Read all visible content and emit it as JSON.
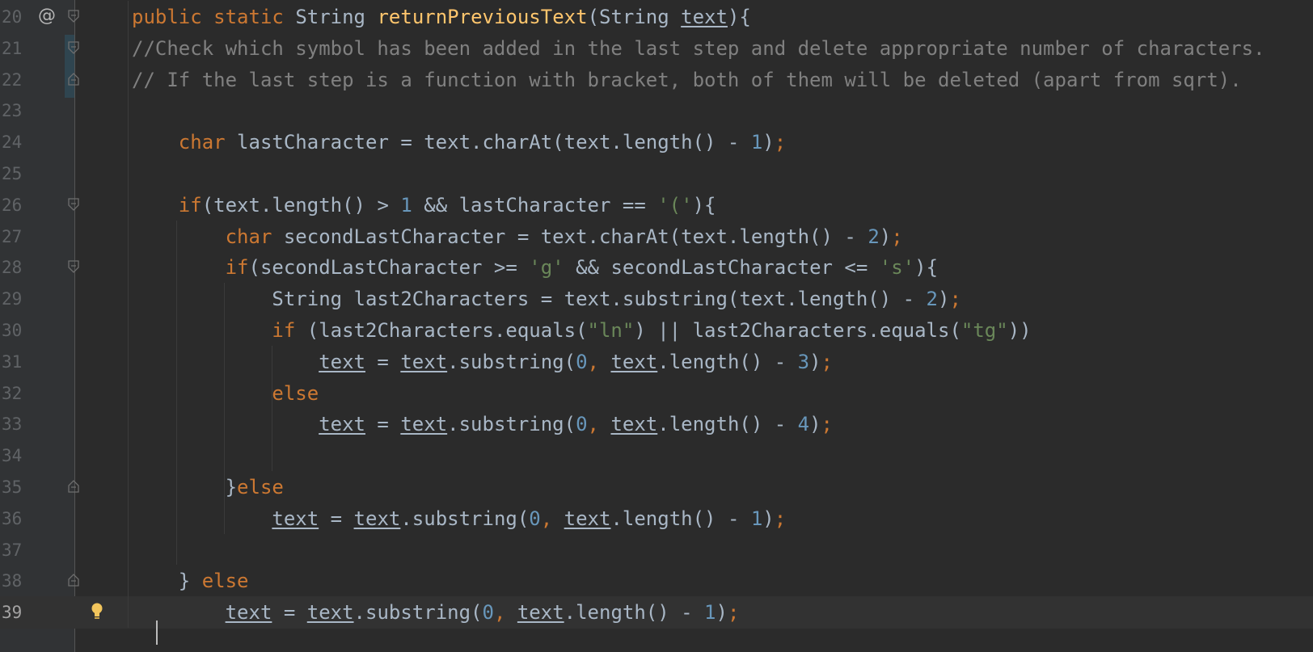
{
  "editor": {
    "language": "Java",
    "current_line": 39,
    "lines": [
      {
        "number": "20",
        "tokens": [
          {
            "t": "public ",
            "c": "kw"
          },
          {
            "t": "static ",
            "c": "kw"
          },
          {
            "t": "String ",
            "c": ""
          },
          {
            "t": "returnPreviousText",
            "c": "fn"
          },
          {
            "t": "(String ",
            "c": ""
          },
          {
            "t": "text",
            "c": "param"
          },
          {
            "t": "){",
            "c": ""
          }
        ]
      },
      {
        "number": "21",
        "tokens": [
          {
            "t": "//Check which symbol has been added in the last step and delete appropriate number of characters.",
            "c": "cm"
          }
        ]
      },
      {
        "number": "22",
        "tokens": [
          {
            "t": "// If the last step is a function with bracket, both of them will be deleted (apart from sqrt).",
            "c": "cm"
          }
        ]
      },
      {
        "number": "23",
        "tokens": []
      },
      {
        "number": "24",
        "tokens": [
          {
            "t": "    ",
            "c": ""
          },
          {
            "t": "char ",
            "c": "kw"
          },
          {
            "t": "lastCharacter = text.charAt(text.length() - ",
            "c": ""
          },
          {
            "t": "1",
            "c": "num"
          },
          {
            "t": ")",
            "c": ""
          },
          {
            "t": ";",
            "c": "kw"
          }
        ]
      },
      {
        "number": "25",
        "tokens": []
      },
      {
        "number": "26",
        "tokens": [
          {
            "t": "    ",
            "c": ""
          },
          {
            "t": "if",
            "c": "kw"
          },
          {
            "t": "(text.length() > ",
            "c": ""
          },
          {
            "t": "1",
            "c": "num"
          },
          {
            "t": " && lastCharacter == ",
            "c": ""
          },
          {
            "t": "'('",
            "c": "str"
          },
          {
            "t": "){",
            "c": ""
          }
        ]
      },
      {
        "number": "27",
        "tokens": [
          {
            "t": "        ",
            "c": ""
          },
          {
            "t": "char ",
            "c": "kw"
          },
          {
            "t": "secondLastCharacter = text.charAt(text.length() - ",
            "c": ""
          },
          {
            "t": "2",
            "c": "num"
          },
          {
            "t": ")",
            "c": ""
          },
          {
            "t": ";",
            "c": "kw"
          }
        ]
      },
      {
        "number": "28",
        "tokens": [
          {
            "t": "        ",
            "c": ""
          },
          {
            "t": "if",
            "c": "kw"
          },
          {
            "t": "(secondLastCharacter >= ",
            "c": ""
          },
          {
            "t": "'g'",
            "c": "str"
          },
          {
            "t": " && secondLastCharacter <= ",
            "c": ""
          },
          {
            "t": "'s'",
            "c": "str"
          },
          {
            "t": "){",
            "c": ""
          }
        ]
      },
      {
        "number": "29",
        "tokens": [
          {
            "t": "            String last2Characters = text.substring(text.length() - ",
            "c": ""
          },
          {
            "t": "2",
            "c": "num"
          },
          {
            "t": ")",
            "c": ""
          },
          {
            "t": ";",
            "c": "kw"
          }
        ]
      },
      {
        "number": "30",
        "tokens": [
          {
            "t": "            ",
            "c": ""
          },
          {
            "t": "if ",
            "c": "kw"
          },
          {
            "t": "(last2Characters.equals(",
            "c": ""
          },
          {
            "t": "\"ln\"",
            "c": "str"
          },
          {
            "t": ") || last2Characters.equals(",
            "c": ""
          },
          {
            "t": "\"tg\"",
            "c": "str"
          },
          {
            "t": "))",
            "c": ""
          }
        ]
      },
      {
        "number": "31",
        "tokens": [
          {
            "t": "                ",
            "c": ""
          },
          {
            "t": "text",
            "c": "param"
          },
          {
            "t": " = ",
            "c": ""
          },
          {
            "t": "text",
            "c": "param"
          },
          {
            "t": ".substring(",
            "c": ""
          },
          {
            "t": "0",
            "c": "num"
          },
          {
            "t": ", ",
            "c": "kw"
          },
          {
            "t": "text",
            "c": "param"
          },
          {
            "t": ".length() - ",
            "c": ""
          },
          {
            "t": "3",
            "c": "num"
          },
          {
            "t": ")",
            "c": ""
          },
          {
            "t": ";",
            "c": "kw"
          }
        ]
      },
      {
        "number": "32",
        "tokens": [
          {
            "t": "            ",
            "c": ""
          },
          {
            "t": "else",
            "c": "kw"
          }
        ]
      },
      {
        "number": "33",
        "tokens": [
          {
            "t": "                ",
            "c": ""
          },
          {
            "t": "text",
            "c": "param"
          },
          {
            "t": " = ",
            "c": ""
          },
          {
            "t": "text",
            "c": "param"
          },
          {
            "t": ".substring(",
            "c": ""
          },
          {
            "t": "0",
            "c": "num"
          },
          {
            "t": ", ",
            "c": "kw"
          },
          {
            "t": "text",
            "c": "param"
          },
          {
            "t": ".length() - ",
            "c": ""
          },
          {
            "t": "4",
            "c": "num"
          },
          {
            "t": ")",
            "c": ""
          },
          {
            "t": ";",
            "c": "kw"
          }
        ]
      },
      {
        "number": "34",
        "tokens": []
      },
      {
        "number": "35",
        "tokens": [
          {
            "t": "        }",
            "c": ""
          },
          {
            "t": "else",
            "c": "kw"
          }
        ]
      },
      {
        "number": "36",
        "tokens": [
          {
            "t": "            ",
            "c": ""
          },
          {
            "t": "text",
            "c": "param"
          },
          {
            "t": " = ",
            "c": ""
          },
          {
            "t": "text",
            "c": "param"
          },
          {
            "t": ".substring(",
            "c": ""
          },
          {
            "t": "0",
            "c": "num"
          },
          {
            "t": ", ",
            "c": "kw"
          },
          {
            "t": "text",
            "c": "param"
          },
          {
            "t": ".length() - ",
            "c": ""
          },
          {
            "t": "1",
            "c": "num"
          },
          {
            "t": ")",
            "c": ""
          },
          {
            "t": ";",
            "c": "kw"
          }
        ]
      },
      {
        "number": "37",
        "tokens": []
      },
      {
        "number": "38",
        "tokens": [
          {
            "t": "    } ",
            "c": ""
          },
          {
            "t": "else",
            "c": "kw"
          }
        ]
      },
      {
        "number": "39",
        "tokens": [
          {
            "t": "        ",
            "c": ""
          },
          {
            "t": "text",
            "c": "param"
          },
          {
            "t": " = ",
            "c": ""
          },
          {
            "t": "text",
            "c": "param"
          },
          {
            "t": ".substring(",
            "c": ""
          },
          {
            "t": "0",
            "c": "num"
          },
          {
            "t": ", ",
            "c": "kw"
          },
          {
            "t": "text",
            "c": "param"
          },
          {
            "t": ".length() - ",
            "c": ""
          },
          {
            "t": "1",
            "c": "num"
          },
          {
            "t": ")",
            "c": ""
          },
          {
            "t": ";",
            "c": "kw"
          }
        ]
      }
    ],
    "gutter_icons": {
      "20": [
        "override-icon",
        "fold-open-icon"
      ],
      "21": [
        "fold-open-icon"
      ],
      "22": [
        "fold-close-icon"
      ],
      "26": [
        "fold-open-icon"
      ],
      "28": [
        "fold-open-icon"
      ],
      "35": [
        "fold-close-icon"
      ],
      "38": [
        "fold-close-icon"
      ],
      "39": [
        "lightbulb-icon"
      ]
    },
    "override_symbol": "@",
    "colors": {
      "background": "#2b2b2b",
      "gutter": "#313335",
      "keyword": "#cc7832",
      "function": "#ffc66d",
      "number": "#6897bb",
      "string": "#6a8759",
      "comment": "#808080",
      "text": "#a9b7c6",
      "current_line": "#323232"
    }
  }
}
